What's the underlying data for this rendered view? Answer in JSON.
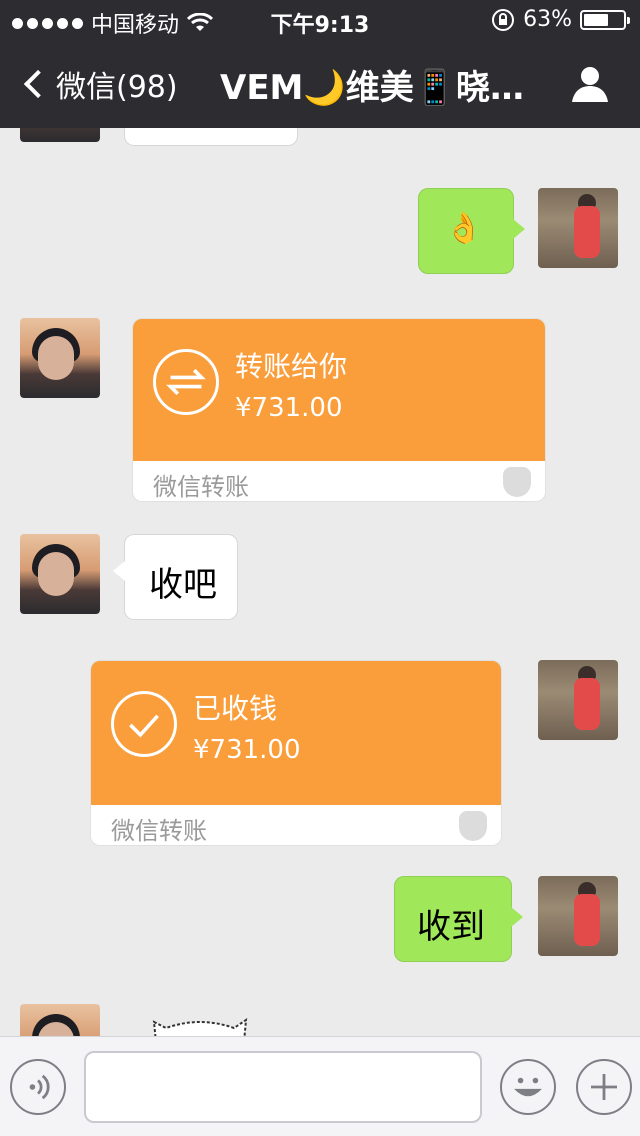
{
  "status_bar": {
    "carrier": "中国移动",
    "time": "下午9:13",
    "battery": "63%",
    "battery_level": 0.63
  },
  "nav": {
    "back_label": "微信(98)",
    "title": "VEM🌙维美📱晓…"
  },
  "messages": [
    {
      "id": "ok-emoji",
      "from": "self",
      "type": "text",
      "text": "👌"
    },
    {
      "id": "transfer-1",
      "from": "other",
      "type": "transfer",
      "title": "转账给你",
      "amount": "¥731.00",
      "footer": "微信转账"
    },
    {
      "id": "take-it",
      "from": "other",
      "type": "text",
      "text": "收吧"
    },
    {
      "id": "transfer-2",
      "from": "self",
      "type": "transfer",
      "title": "已收钱",
      "amount": "¥731.00",
      "footer": "微信转账"
    },
    {
      "id": "received",
      "from": "self",
      "type": "text",
      "text": "收到"
    }
  ],
  "icons": {
    "back": "chevron-left-icon",
    "profile": "person-icon",
    "voice": "voice-icon",
    "emoji": "smiley-icon",
    "plus": "plus-icon",
    "transfer": "transfer-arrows-icon",
    "received": "checkmark-icon",
    "wechat_pay_shield": "shield-icon"
  },
  "colors": {
    "nav_bg": "#2c2c31",
    "chat_bg": "#ebebeb",
    "bubble_green": "#a0e75a",
    "transfer_orange": "#fa9d3b"
  }
}
